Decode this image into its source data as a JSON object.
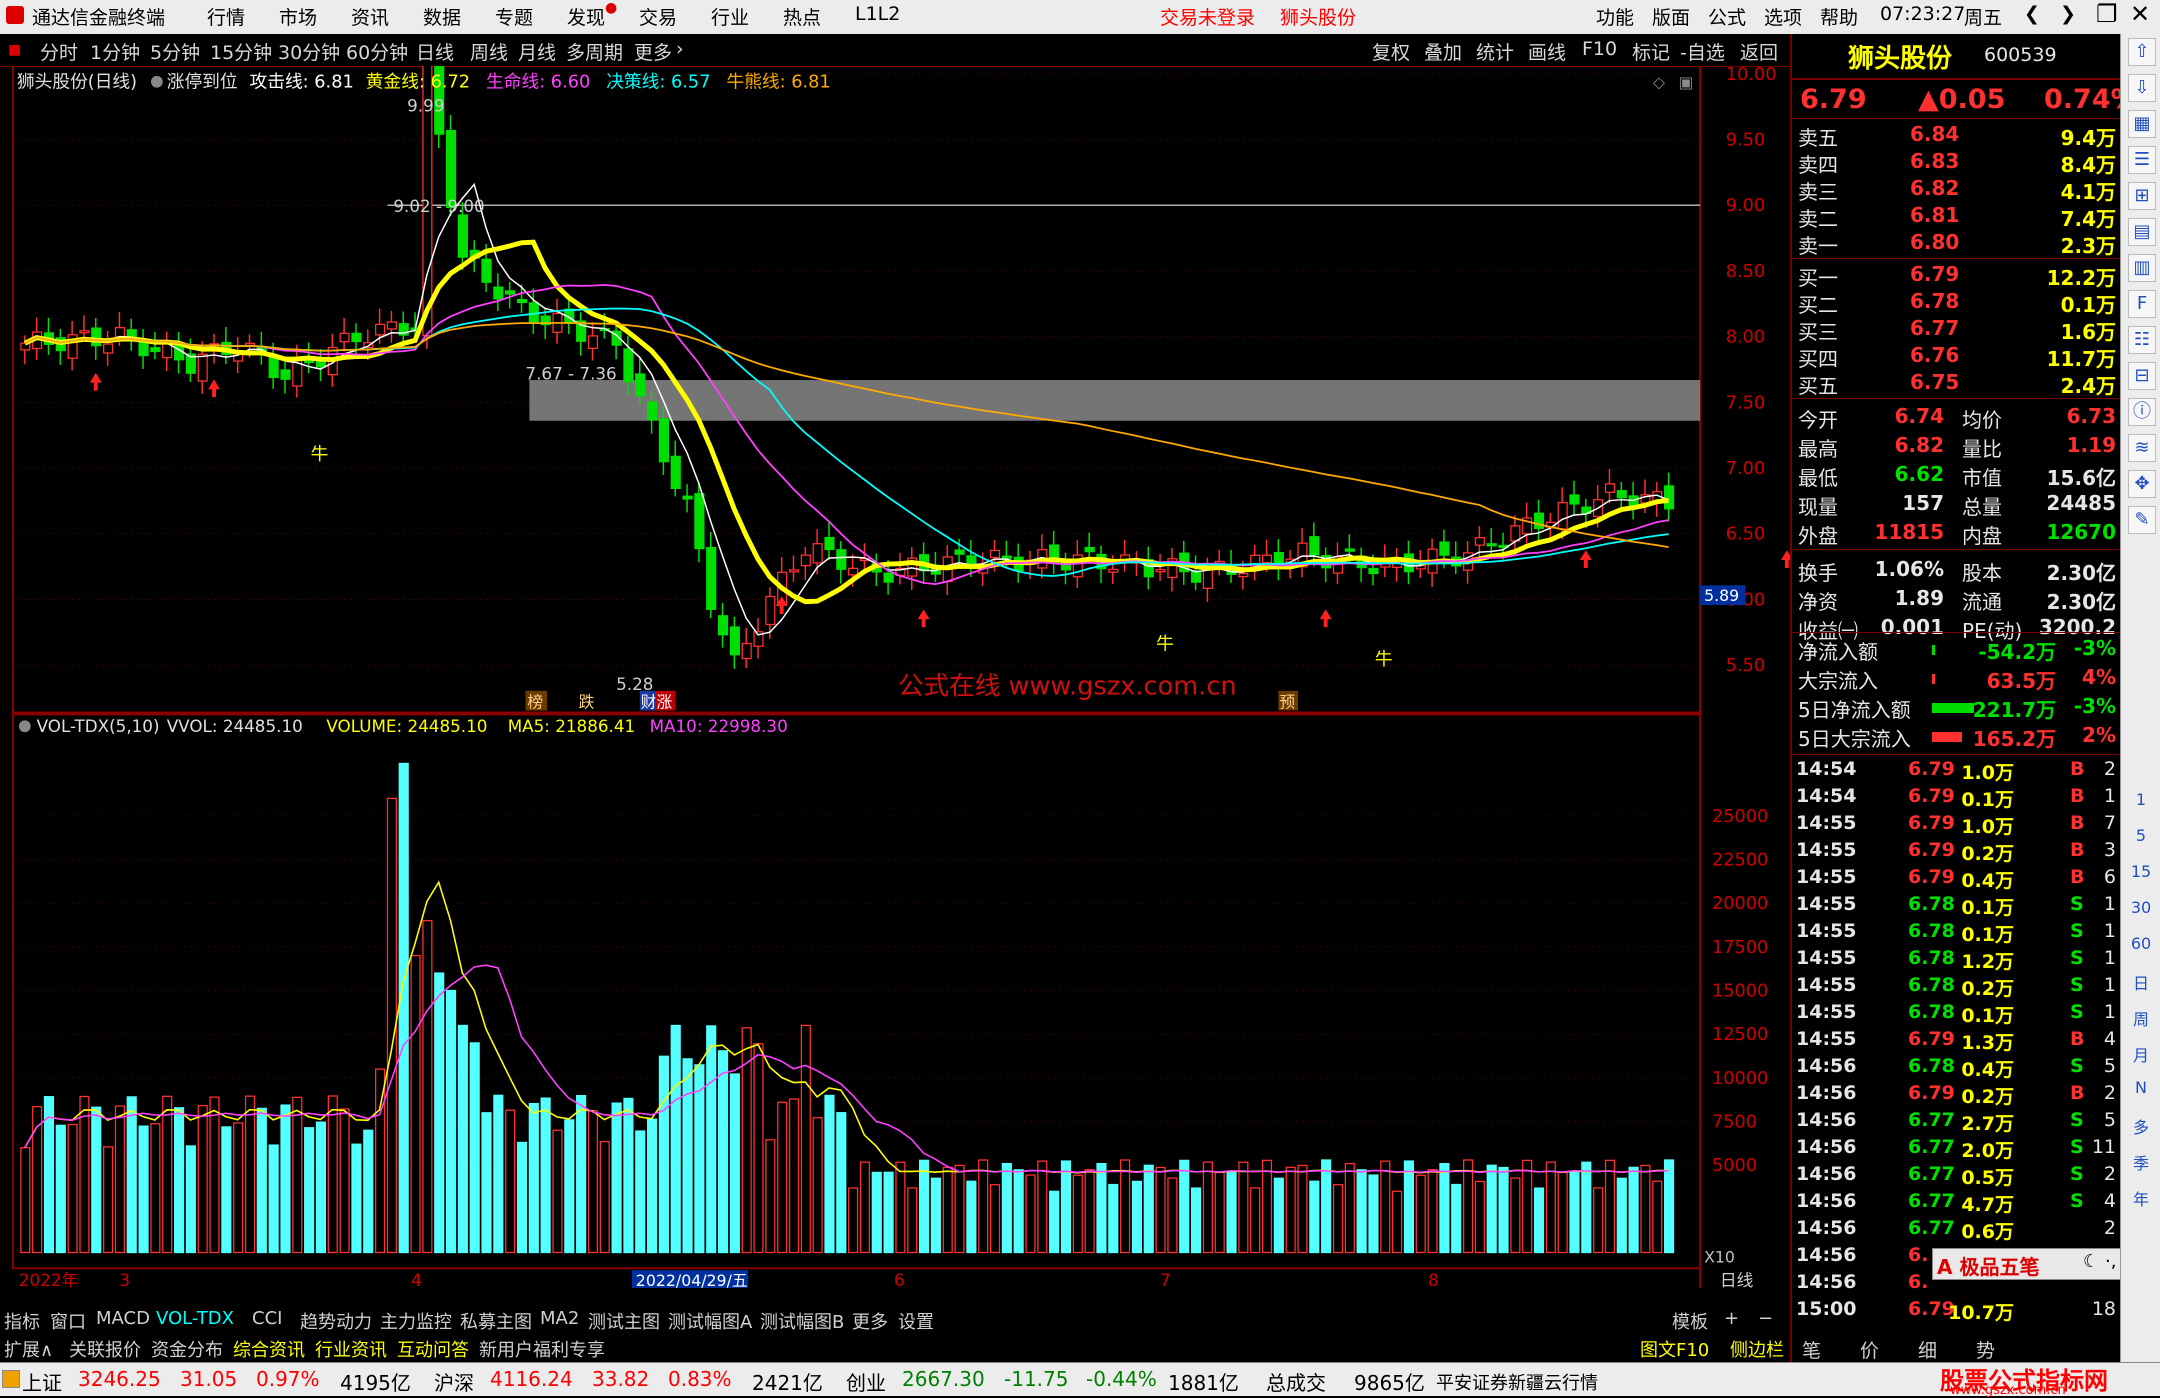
{
  "menubar": {
    "app_title": "通达信金融终端",
    "menus": [
      "行情",
      "市场",
      "资讯",
      "数据",
      "专题",
      "发现",
      "交易",
      "行业",
      "热点",
      "L1L2"
    ],
    "login_status": "交易未登录",
    "stock_name": "狮头股份",
    "right_menus": [
      "功能",
      "版面",
      "公式",
      "选项",
      "帮助"
    ],
    "time": "07:23:27",
    "weekday": "周五"
  },
  "toolbar": {
    "periods": [
      "分时",
      "1分钟",
      "5分钟",
      "15分钟",
      "30分钟",
      "60分钟",
      "日线",
      "周线",
      "月线",
      "多周期",
      "更多"
    ],
    "active_period": "日线",
    "right_buttons": [
      "复权",
      "叠加",
      "统计",
      "画线",
      "F10",
      "标记",
      "-自选",
      "返回"
    ]
  },
  "chart_data": [
    {
      "type": "candlestick",
      "title": "狮头股份(日线)",
      "indicator_name": "涨停到位",
      "indicator_lines": [
        {
          "name": "攻击线",
          "value": "6.81",
          "color": "#ffffff"
        },
        {
          "name": "黄金线",
          "value": "6.72",
          "color": "#ffff00"
        },
        {
          "name": "生命线",
          "value": "6.60",
          "color": "#ff40ff"
        },
        {
          "name": "决策线",
          "value": "6.57",
          "color": "#00ffff"
        },
        {
          "name": "牛熊线",
          "value": "6.81",
          "color": "#ffaa00"
        }
      ],
      "y_ticks": [
        "10.00",
        "9.50",
        "9.00",
        "8.50",
        "8.00",
        "7.50",
        "7.00",
        "6.50",
        "6.00",
        "5.50"
      ],
      "ylim": [
        5.2,
        10.0
      ],
      "current_price_marker": "5.89",
      "annotations": [
        "9.99",
        "9.02 - 9.00",
        "7.67 - 7.36",
        "5.28"
      ],
      "markers": [
        "榜",
        "跌",
        "财",
        "涨",
        "预"
      ],
      "signal_text": "牛",
      "watermark": "公式在线  www.gszx.com.cn",
      "resistance_band": [
        7.36,
        7.67
      ],
      "resistance_line": 9.0
    },
    {
      "type": "bar",
      "title": "VOL-TDX(5,10)",
      "legend": [
        {
          "name": "VVOL",
          "value": "24485.10",
          "color": "#e0e0e0"
        },
        {
          "name": "VOLUME",
          "value": "24485.10",
          "color": "#ffff00"
        },
        {
          "name": "MA5",
          "value": "21886.41",
          "color": "#ffff00"
        },
        {
          "name": "MA10",
          "value": "22998.30",
          "color": "#ff40ff"
        }
      ],
      "y_ticks": [
        "25000",
        "22500",
        "20000",
        "17500",
        "15000",
        "12500",
        "10000",
        "7500",
        "5000"
      ],
      "ylim": [
        0,
        29000
      ],
      "unit_label": "X10"
    }
  ],
  "xaxis": {
    "labels": [
      "2022年",
      "3",
      "4",
      "2022/04/29/五",
      "6",
      "7",
      "8"
    ],
    "period_label": "日线"
  },
  "bottombar1": {
    "tabs": [
      "指标",
      "窗口",
      "MACD",
      "VOL-TDX",
      "CCI",
      "趋势动力",
      "主力监控",
      "私募主图",
      "MA2",
      "测试主图",
      "测试幅图A",
      "测试幅图B",
      "更多",
      "设置"
    ],
    "right": [
      "模板",
      "+",
      "−"
    ]
  },
  "bottombar2": {
    "tabs": [
      "扩展∧",
      "关联报价",
      "资金分布",
      "综合资讯",
      "行业资讯",
      "互动问答",
      "新用户福利专享"
    ],
    "right": [
      "图文F10",
      "侧边栏《"
    ]
  },
  "quote": {
    "name": "狮头股份",
    "code": "600539",
    "price": "6.79",
    "change": "▲0.05",
    "change_pct": "0.74%",
    "asks": [
      {
        "label": "卖五",
        "price": "6.84",
        "vol": "9.4万"
      },
      {
        "label": "卖四",
        "price": "6.83",
        "vol": "8.4万"
      },
      {
        "label": "卖三",
        "price": "6.82",
        "vol": "4.1万"
      },
      {
        "label": "卖二",
        "price": "6.81",
        "vol": "7.4万"
      },
      {
        "label": "卖一",
        "price": "6.80",
        "vol": "2.3万"
      }
    ],
    "bids": [
      {
        "label": "买一",
        "price": "6.79",
        "vol": "12.2万"
      },
      {
        "label": "买二",
        "price": "6.78",
        "vol": "0.1万"
      },
      {
        "label": "买三",
        "price": "6.77",
        "vol": "1.6万"
      },
      {
        "label": "买四",
        "price": "6.76",
        "vol": "11.7万"
      },
      {
        "label": "买五",
        "price": "6.75",
        "vol": "2.4万"
      }
    ],
    "stats": [
      [
        "今开",
        "6.74",
        "均价",
        "6.73"
      ],
      [
        "最高",
        "6.82",
        "量比",
        "1.19"
      ],
      [
        "最低",
        "6.62",
        "市值",
        "15.6亿"
      ],
      [
        "现量",
        "157",
        "总量",
        "24485"
      ],
      [
        "外盘",
        "11815",
        "内盘",
        "12670"
      ],
      [
        "换手",
        "1.06%",
        "股本",
        "2.30亿"
      ],
      [
        "净资",
        "1.89",
        "流通",
        "2.30亿"
      ],
      [
        "收益㈠",
        "0.001",
        "PE(动)",
        "3200.2"
      ]
    ],
    "flows": [
      {
        "label": "净流入额",
        "value": "-54.2万",
        "pct": "-3%",
        "bar": 0.05
      },
      {
        "label": "大宗流入",
        "value": "63.5万",
        "pct": "4%",
        "bar": 0.05
      },
      {
        "label": "5日净流入额",
        "value": "-221.7万",
        "pct": "-3%",
        "bar": 0.7
      },
      {
        "label": "5日大宗流入",
        "value": "165.2万",
        "pct": "2%",
        "bar": 0.5
      }
    ],
    "ticks": [
      [
        "14:54",
        "6.79",
        "1.0万",
        "B",
        "2"
      ],
      [
        "14:54",
        "6.79",
        "0.1万",
        "B",
        "1"
      ],
      [
        "14:55",
        "6.79",
        "1.0万",
        "B",
        "7"
      ],
      [
        "14:55",
        "6.79",
        "0.2万",
        "B",
        "3"
      ],
      [
        "14:55",
        "6.79",
        "0.4万",
        "B",
        "6"
      ],
      [
        "14:55",
        "6.78",
        "0.1万",
        "S",
        "1"
      ],
      [
        "14:55",
        "6.78",
        "0.1万",
        "S",
        "1"
      ],
      [
        "14:55",
        "6.78",
        "1.2万",
        "S",
        "1"
      ],
      [
        "14:55",
        "6.78",
        "0.2万",
        "S",
        "1"
      ],
      [
        "14:55",
        "6.78",
        "0.1万",
        "S",
        "1"
      ],
      [
        "14:55",
        "6.79",
        "1.3万",
        "B",
        "4"
      ],
      [
        "14:56",
        "6.78",
        "0.4万",
        "S",
        "5"
      ],
      [
        "14:56",
        "6.79",
        "0.2万",
        "B",
        "2"
      ],
      [
        "14:56",
        "6.77",
        "2.7万",
        "S",
        "5"
      ],
      [
        "14:56",
        "6.77",
        "2.0万",
        "S",
        "11"
      ],
      [
        "14:56",
        "6.77",
        "0.5万",
        "S",
        "2"
      ],
      [
        "14:56",
        "6.77",
        "4.7万",
        "S",
        "4"
      ],
      [
        "14:56",
        "6.77",
        "0.6万",
        "",
        "2"
      ],
      [
        "14:56",
        "6.",
        "",
        "",
        ""
      ],
      [
        "14:56",
        "6.",
        "",
        "",
        ""
      ],
      [
        "15:00",
        "6.79",
        "10.7万",
        "",
        "18"
      ]
    ],
    "ime": "A 极品五笔",
    "bottom_tabs": [
      "笔",
      "价",
      "细",
      "势"
    ]
  },
  "statusbar": {
    "items": [
      {
        "label": "上证",
        "value": "3246.25",
        "chg": "31.05",
        "pct": "0.97%",
        "amt": "4195亿"
      },
      {
        "label": "沪深",
        "value": "4116.24",
        "chg": "33.82",
        "pct": "0.83%",
        "amt": "2421亿"
      },
      {
        "label": "创业",
        "value": "2667.30",
        "chg": "-11.75",
        "pct": "-0.44%",
        "amt": "1881亿"
      }
    ],
    "total_label": "总成交",
    "total_value": "9865亿",
    "broker": "平安证券新疆云行情",
    "watermark": "股票公式指标网",
    "watermark_url": "www.gszx.com.cn"
  },
  "side_icons": [
    "up-arrow-icon",
    "down-arrow-icon",
    "grid-icon",
    "list-icon",
    "chart-icon",
    "bar-icon",
    "table-icon",
    "f10-icon",
    "doc-icon",
    "fs-icon",
    "info-icon",
    "rsi-icon",
    "move-icon",
    "pen-icon"
  ],
  "side_numbers": [
    "1",
    "5",
    "15",
    "30",
    "60",
    "日",
    "周",
    "月",
    "N",
    "多",
    "季",
    "年"
  ]
}
